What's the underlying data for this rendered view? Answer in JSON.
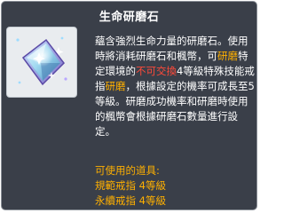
{
  "tooltip": {
    "title": "生命研磨石",
    "icon": "gemstone-shard-icon",
    "description": {
      "p1": "蘊含強烈生命力量的研磨石。使用時將消耗研磨石和楓幣，可",
      "hl1": "研磨",
      "p2": "特定環境的",
      "hl2": "不可交換",
      "p3": "4等級特殊技能戒指",
      "hl3": "研磨",
      "p4": "，根據設定的機率可成長至5等級。研磨成功機率和研磨時使用的楓幣會根據研磨石數量進行設定。"
    },
    "usable": {
      "header": "可使用的道具:",
      "items": [
        "規範戒指 4等級",
        "永續戒指 4等級"
      ]
    }
  },
  "colors": {
    "background": "#3a3f49",
    "highlight": "#ffb000",
    "warning": "#ff4a3a",
    "text": "#ffffff"
  }
}
